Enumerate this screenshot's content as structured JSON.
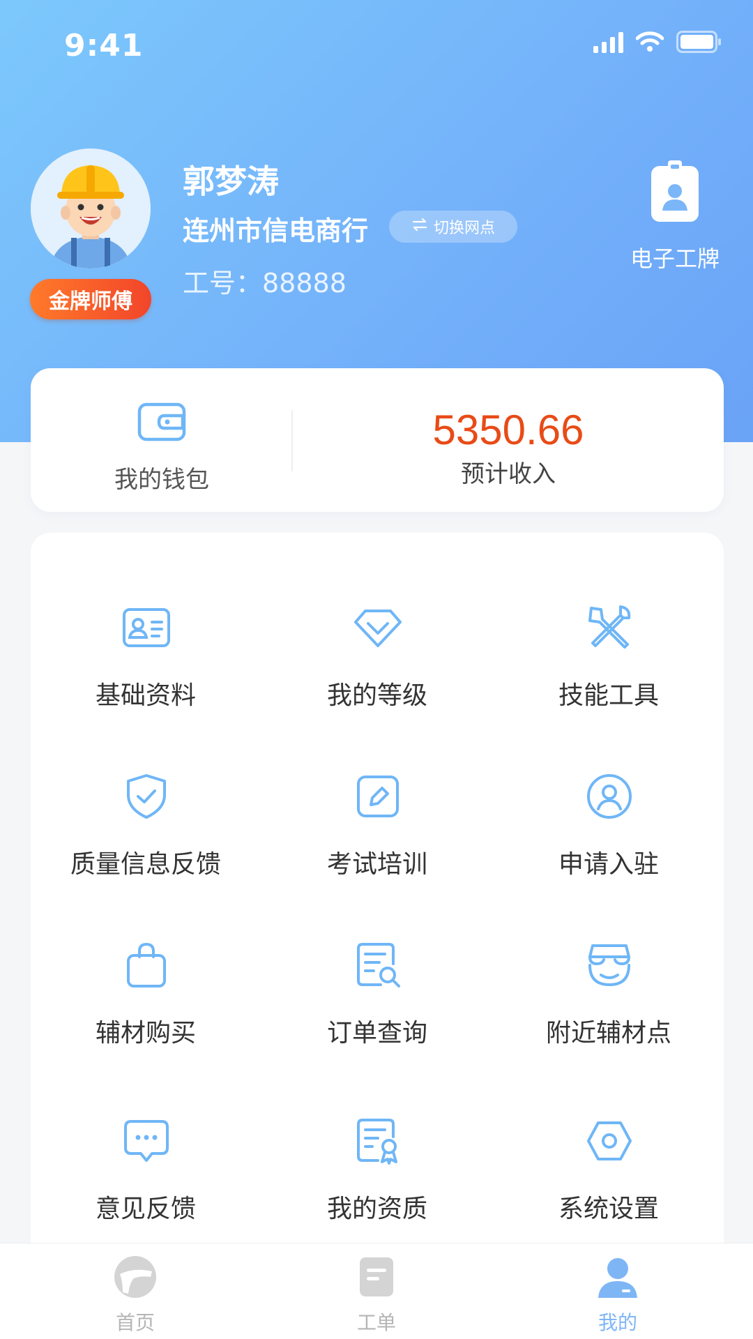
{
  "status_bar": {
    "time": "9:41"
  },
  "profile": {
    "name": "郭梦涛",
    "shop": "连州市信电商行",
    "switch_label": "切换网点",
    "employee_no": "工号：88888",
    "rank_badge": "金牌师傅",
    "badge_button_label": "电子工牌"
  },
  "wallet": {
    "label": "我的钱包",
    "income_value": "5350.66",
    "income_label": "预计收入"
  },
  "menu": [
    {
      "label": "基础资料",
      "icon": "id-card-icon"
    },
    {
      "label": "我的等级",
      "icon": "diamond-icon"
    },
    {
      "label": "技能工具",
      "icon": "tools-icon"
    },
    {
      "label": "质量信息反馈",
      "icon": "shield-check-icon"
    },
    {
      "label": "考试培训",
      "icon": "edit-icon"
    },
    {
      "label": "申请入驻",
      "icon": "user-circle-icon"
    },
    {
      "label": "辅材购买",
      "icon": "shopping-bag-icon"
    },
    {
      "label": "订单查询",
      "icon": "document-search-icon"
    },
    {
      "label": "附近辅材点",
      "icon": "store-icon"
    },
    {
      "label": "意见反馈",
      "icon": "chat-bubble-icon"
    },
    {
      "label": "我的资质",
      "icon": "certificate-icon"
    },
    {
      "label": "系统设置",
      "icon": "hexagon-settings-icon"
    }
  ],
  "tab_bar": {
    "items": [
      {
        "label": "首页",
        "icon": "home-icon"
      },
      {
        "label": "工单",
        "icon": "work-order-icon"
      },
      {
        "label": "我的",
        "icon": "profile-icon"
      }
    ],
    "active_index": 2
  },
  "colors": {
    "accent": "#6fb6f6",
    "income": "#e84b17",
    "header_start": "#7cc8fc",
    "header_end": "#6aa3f7",
    "rank_badge": "#f2452a"
  }
}
